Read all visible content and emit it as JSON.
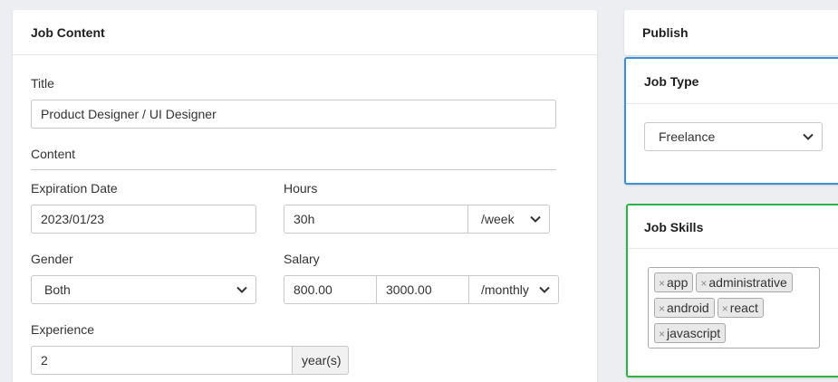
{
  "job_content": {
    "header": "Job Content",
    "title_label": "Title",
    "title_value": "Product Designer / UI Designer",
    "content_label": "Content",
    "expiration_label": "Expiration Date",
    "expiration_value": "2023/01/23",
    "hours_label": "Hours",
    "hours_value": "30h",
    "hours_unit": "/week",
    "gender_label": "Gender",
    "gender_value": "Both",
    "salary_label": "Salary",
    "salary_min": "800.00",
    "salary_max": "3000.00",
    "salary_period": "/monthly",
    "experience_label": "Experience",
    "experience_value": "2",
    "experience_unit": "year(s)"
  },
  "publish": {
    "header": "Publish"
  },
  "job_type": {
    "header": "Job Type",
    "value": "Freelance"
  },
  "job_skills": {
    "header": "Job Skills",
    "tags": [
      "app",
      "administrative",
      "android",
      "react",
      "javascript"
    ],
    "remove_glyph": "×"
  },
  "colors": {
    "job_type_border": "#3e8fd6",
    "job_skills_border": "#2db34a",
    "background": "#eceef1"
  }
}
